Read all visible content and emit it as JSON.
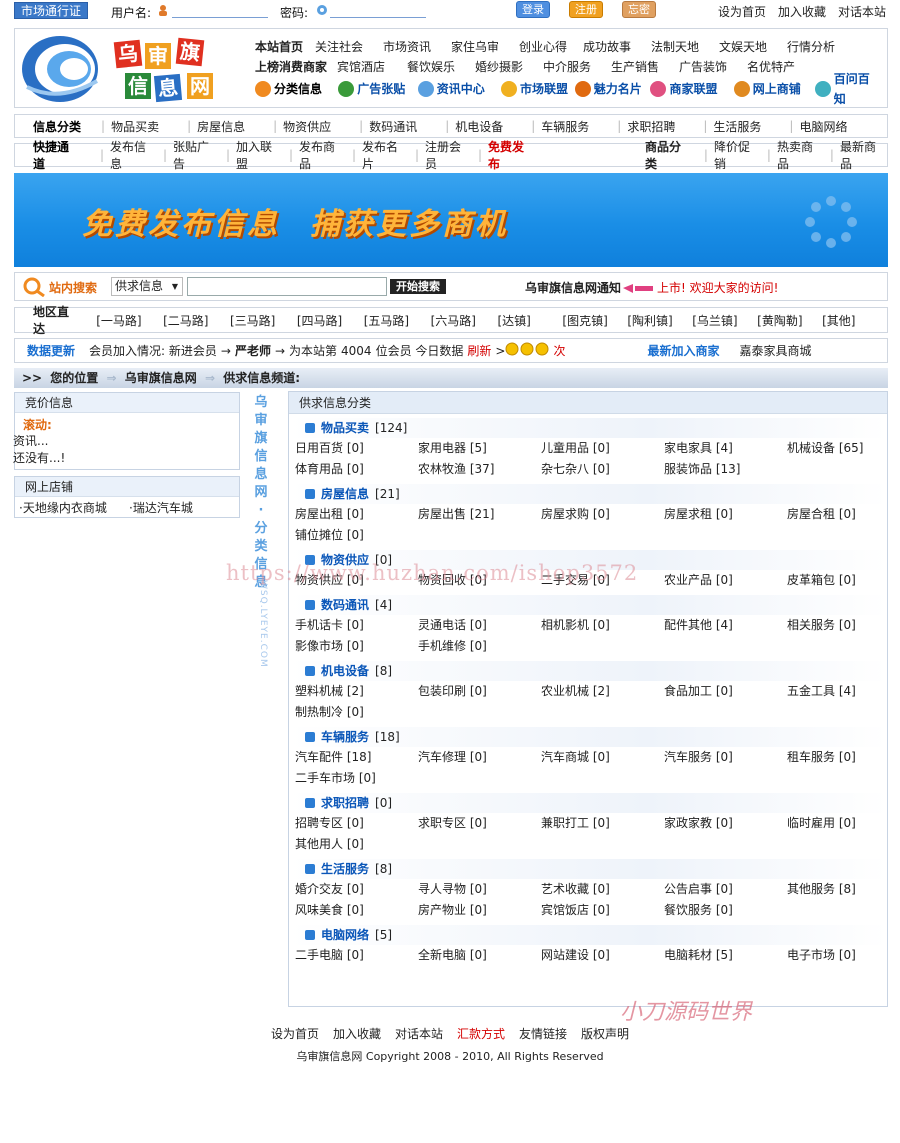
{
  "topbar": {
    "pass_label": "市场通行证",
    "username_label": "用户名:",
    "password_label": "密码:",
    "login": "登录",
    "register": "注册",
    "forgot": "忘密",
    "links": [
      "设为首页",
      "加入收藏",
      "对话本站"
    ]
  },
  "logo": {
    "chars": [
      "乌",
      "审",
      "旗",
      "信",
      "息",
      "网"
    ]
  },
  "nav": {
    "row1": [
      "本站首页",
      "关注社会",
      "市场资讯",
      "家住乌审",
      "创业心得",
      "成功故事",
      "法制天地",
      "文娱天地",
      "行情分析"
    ],
    "row2": [
      "上榜消费商家",
      "宾馆酒店",
      "餐饮娱乐",
      "婚纱摄影",
      "中介服务",
      "生产销售",
      "广告装饰",
      "名优特产"
    ],
    "row3": [
      "分类信息",
      "广告张贴",
      "资讯中心",
      "市场联盟",
      "魅力名片",
      "商家联盟",
      "网上商铺",
      "百问百知"
    ]
  },
  "infobar": {
    "title": "信息分类",
    "items": [
      "物品买卖",
      "房屋信息",
      "物资供应",
      "数码通讯",
      "机电设备",
      "车辆服务",
      "求职招聘",
      "生活服务",
      "电脑网络"
    ]
  },
  "quickbar": {
    "title": "快捷通道",
    "items": [
      "发布信息",
      "张贴广告",
      "加入联盟",
      "发布商品",
      "发布名片",
      "注册会员"
    ],
    "highlight": "免费发布",
    "goods_title": "商品分类",
    "goods": [
      "降价促销",
      "热卖商品",
      "最新商品"
    ]
  },
  "banner": {
    "text1": "免费发布信息",
    "text2": "捕获更多商机"
  },
  "search": {
    "label": "站内搜索",
    "select": "供求信息",
    "button": "开始搜索",
    "notice_title": "乌审旗信息网通知",
    "notice": "上市! 欢迎大家的访问!"
  },
  "region": {
    "title": "地区直达",
    "items": [
      "[一马路]",
      "[二马路]",
      "[三马路]",
      "[四马路]",
      "[五马路]",
      "[六马路]",
      "[达镇]",
      "[图克镇]",
      "[陶利镇]",
      "[乌兰镇]",
      "[黄陶勒]",
      "[其他]"
    ]
  },
  "stats": {
    "title": "数据更新",
    "text1": "会员加入情况: 新进会员",
    "arrow": "→",
    "member": "严老师",
    "text2": "为本站第",
    "count": "4004",
    "text3": "位会员 今日数据",
    "refresh": "刷新",
    "gt": ">",
    "times": "次",
    "newest_label": "最新加入商家",
    "newest": "嘉泰家具商城"
  },
  "location": {
    "prefix": ">>",
    "label": "您的位置",
    "site": "乌审旗信息网",
    "channel": "供求信息频道:"
  },
  "left": {
    "bid_title": "竞价信息",
    "scroll_label": "滚动:",
    "line1": "资讯...",
    "line2": "还没有...!",
    "shop_title": "网上店铺",
    "shops": [
      "·天地缘内衣商城",
      "·瑞达汽车城"
    ]
  },
  "vertical": [
    "乌",
    "审",
    "旗",
    "信",
    "息",
    "网",
    "·",
    "分",
    "类",
    "信",
    "息"
  ],
  "vertical_en": "WSQ.LYEYE.COM",
  "main": {
    "title": "供求信息分类",
    "cats": [
      {
        "name": "物品买卖",
        "count": "[124]",
        "items": [
          "日用百货 [0]",
          "家用电器 [5]",
          "儿童用品 [0]",
          "家电家具 [4]",
          "机械设备 [65]",
          "体育用品 [0]",
          "农林牧渔 [37]",
          "杂七杂八 [0]",
          "服装饰品 [13]"
        ]
      },
      {
        "name": "房屋信息",
        "count": "[21]",
        "items": [
          "房屋出租 [0]",
          "房屋出售 [21]",
          "房屋求购 [0]",
          "房屋求租 [0]",
          "房屋合租 [0]",
          "铺位摊位 [0]"
        ]
      },
      {
        "name": "物资供应",
        "count": "[0]",
        "items": [
          "物资供应 [0]",
          "物资回收 [0]",
          "二手交易 [0]",
          "农业产品 [0]",
          "皮革箱包 [0]"
        ]
      },
      {
        "name": "数码通讯",
        "count": "[4]",
        "items": [
          "手机话卡 [0]",
          "灵通电话 [0]",
          "相机影机 [0]",
          "配件其他 [4]",
          "相关服务 [0]",
          "影像市场 [0]",
          "手机维修 [0]"
        ]
      },
      {
        "name": "机电设备",
        "count": "[8]",
        "items": [
          "塑料机械 [2]",
          "包装印刷 [0]",
          "农业机械 [2]",
          "食品加工 [0]",
          "五金工具 [4]",
          "制热制冷 [0]"
        ]
      },
      {
        "name": "车辆服务",
        "count": "[18]",
        "items": [
          "汽车配件 [18]",
          "汽车修理 [0]",
          "汽车商城 [0]",
          "汽车服务 [0]",
          "租车服务 [0]",
          "二手车市场 [0]"
        ]
      },
      {
        "name": "求职招聘",
        "count": "[0]",
        "items": [
          "招聘专区 [0]",
          "求职专区 [0]",
          "兼职打工 [0]",
          "家政家教 [0]",
          "临时雇用 [0]",
          "其他用人 [0]"
        ]
      },
      {
        "name": "生活服务",
        "count": "[8]",
        "items": [
          "婚介交友 [0]",
          "寻人寻物 [0]",
          "艺术收藏 [0]",
          "公告启事 [0]",
          "其他服务 [8]",
          "风味美食 [0]",
          "房产物业 [0]",
          "宾馆饭店 [0]",
          "餐饮服务 [0]"
        ]
      },
      {
        "name": "电脑网络",
        "count": "[5]",
        "items": [
          "二手电脑 [0]",
          "全新电脑 [0]",
          "网站建设 [0]",
          "电脑耗材 [5]",
          "电子市场 [0]"
        ]
      }
    ]
  },
  "watermark1": "https://www.huzhan.com/ishop3572",
  "watermark2": "小刀源码世界",
  "footer": {
    "links": [
      "设为首页",
      "加入收藏",
      "对话本站",
      "汇款方式",
      "友情链接",
      "版权声明"
    ],
    "copyright": "乌审旗信息网 Copyright 2008 - 2010, All Rights Reserved"
  },
  "colors": {
    "brand_blue": "#0a56b8",
    "highlight_red": "#d40000",
    "banner_blue": "#1a8ee6",
    "banner_text": "#ffb43a"
  }
}
